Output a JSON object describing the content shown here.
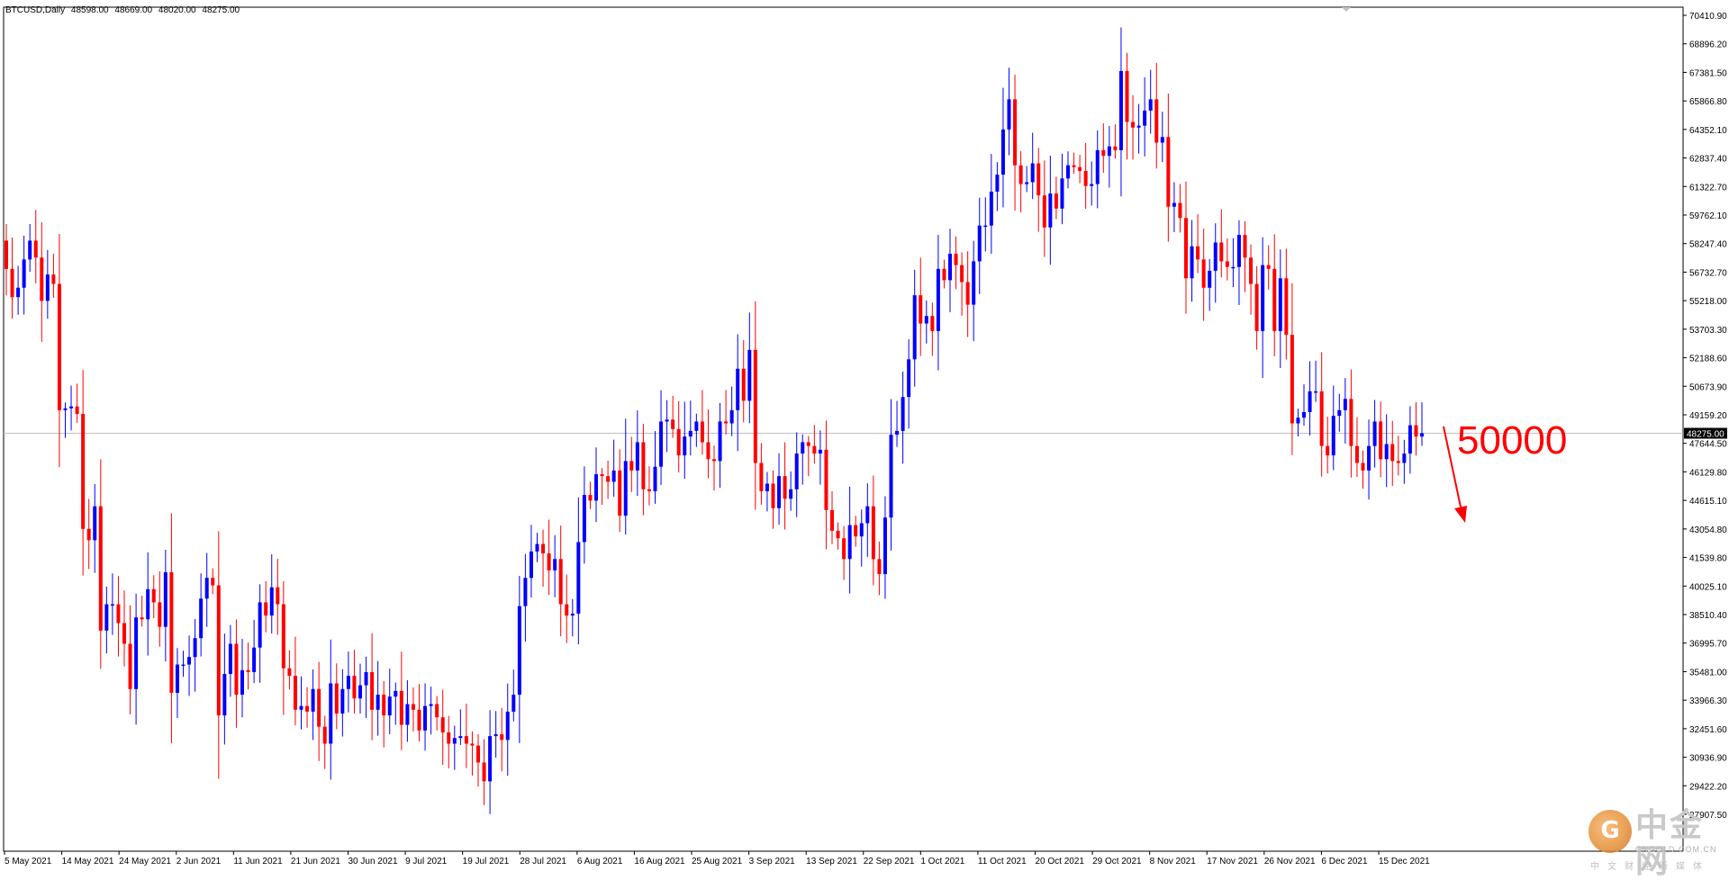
{
  "header": {
    "symbol": "BTCUSD,Daily",
    "open": "48598.00",
    "high": "48669.00",
    "low": "48020.00",
    "close": "48275.00"
  },
  "price_axis": {
    "labels": [
      "70410.90",
      "68896.20",
      "67381.50",
      "65866.80",
      "64352.10",
      "62837.40",
      "61322.70",
      "59762.10",
      "58247.40",
      "56732.70",
      "55218.00",
      "53703.30",
      "52188.60",
      "50673.90",
      "49159.20",
      "47644.50",
      "46129.80",
      "44615.10",
      "43054.80",
      "41539.80",
      "40025.10",
      "38510.40",
      "36995.70",
      "35481.00",
      "33966.30",
      "32451.60",
      "30936.90",
      "29422.20",
      "27907.50"
    ],
    "current_price_label": "48275.00"
  },
  "time_axis": {
    "labels": [
      "5 May 2021",
      "14 May 2021",
      "24 May 2021",
      "2 Jun 2021",
      "11 Jun 2021",
      "21 Jun 2021",
      "30 Jun 2021",
      "9 Jul 2021",
      "19 Jul 2021",
      "28 Jul 2021",
      "6 Aug 2021",
      "16 Aug 2021",
      "25 Aug 2021",
      "3 Sep 2021",
      "13 Sep 2021",
      "22 Sep 2021",
      "1 Oct 2021",
      "11 Oct 2021",
      "20 Oct 2021",
      "29 Oct 2021",
      "8 Nov 2021",
      "17 Nov 2021",
      "26 Nov 2021",
      "6 Dec 2021",
      "15 Dec 2021"
    ]
  },
  "annotation": {
    "text": "50000",
    "color": "#ff0000"
  },
  "watermark": {
    "title": "中金网",
    "subtitle": "CNGOLD.COM.CN",
    "tagline": "中文财经新媒体",
    "logo_glyph": "G"
  },
  "colors": {
    "bull": "#0000ff",
    "bear": "#ff0000",
    "grid_line": "#c0c0c0",
    "axis": "#000000",
    "background": "#ffffff"
  },
  "chart_data": {
    "type": "candlestick",
    "ylim": [
      27907.5,
      70410.9
    ],
    "current_price": 48275,
    "x_labels": [
      "5 May 2021",
      "14 May 2021",
      "24 May 2021",
      "2 Jun 2021",
      "11 Jun 2021",
      "21 Jun 2021",
      "30 Jun 2021",
      "9 Jul 2021",
      "19 Jul 2021",
      "28 Jul 2021",
      "6 Aug 2021",
      "16 Aug 2021",
      "25 Aug 2021",
      "3 Sep 2021",
      "13 Sep 2021",
      "22 Sep 2021",
      "1 Oct 2021",
      "11 Oct 2021",
      "20 Oct 2021",
      "29 Oct 2021",
      "8 Nov 2021",
      "17 Nov 2021",
      "26 Nov 2021",
      "6 Dec 2021",
      "15 Dec 2021"
    ],
    "closes": [
      57000,
      55500,
      56000,
      57500,
      58500,
      57600,
      55300,
      56700,
      56200,
      49500,
      49600,
      49700,
      49300,
      43200,
      42600,
      44400,
      37800,
      39200,
      39200,
      38200,
      37100,
      34700,
      38500,
      38400,
      40000,
      39300,
      38000,
      40900,
      34500,
      36000,
      36000,
      36400,
      37400,
      39500,
      40600,
      40200,
      33300,
      35500,
      37100,
      34400,
      35700,
      35600,
      36900,
      39300,
      38600,
      40100,
      39200,
      35800,
      35400,
      33600,
      33800,
      33500,
      34700,
      32700,
      31800,
      35000,
      33400,
      34700,
      35400,
      34200,
      34900,
      35600,
      33600,
      34400,
      33300,
      34300,
      34600,
      32800,
      33900,
      33600,
      32500,
      33800,
      33900,
      33200,
      32400,
      31800,
      32100,
      32200,
      31800,
      31700,
      30800,
      29800,
      32200,
      32300,
      32000,
      33500,
      34400,
      39100,
      40600,
      42000,
      42400,
      41900,
      41000,
      41600,
      39200,
      38600,
      38700,
      42500,
      45000,
      44700,
      46100,
      46000,
      45700,
      46300,
      43900,
      46800,
      46300,
      47800,
      45300,
      45200,
      46500,
      48900,
      49000,
      48500,
      47100,
      48100,
      48400,
      48900,
      47800,
      46900,
      46800,
      48900,
      48800,
      49500,
      51700,
      50000,
      52700,
      46700,
      45200,
      45600,
      44300,
      46000,
      44800,
      45300,
      47200,
      47800,
      47600,
      47200,
      47400,
      44200,
      43100,
      42700,
      41600,
      43400,
      42800,
      43500,
      44400,
      41600,
      40800,
      43800,
      48200,
      48400,
      50200,
      52200,
      55600,
      54100,
      54500,
      53700,
      57000,
      56400,
      57800,
      57200,
      56300,
      55100,
      57400,
      59300,
      59300,
      61100,
      62000,
      64400,
      66000,
      62500,
      61500,
      61600,
      62600,
      60900,
      59200,
      61000,
      60200,
      61800,
      62500,
      62400,
      62200,
      61400,
      61500,
      63300,
      63000,
      63500,
      63300,
      67500,
      64800,
      64500,
      64600,
      65400,
      66000,
      63700,
      64000,
      60300,
      60500,
      59700,
      56500,
      58200,
      57500,
      56000,
      56900,
      58400,
      57400,
      57100,
      57100,
      58800,
      57600,
      56200,
      53700,
      57200,
      57000,
      53700,
      56500,
      53500,
      48800,
      49100,
      49400,
      50500,
      50500,
      47600,
      47100,
      49200,
      49500,
      50100,
      47600,
      46700,
      46300,
      47600,
      48900,
      46900,
      47700,
      46800,
      46700,
      47200,
      48700,
      48100,
      48275
    ]
  }
}
